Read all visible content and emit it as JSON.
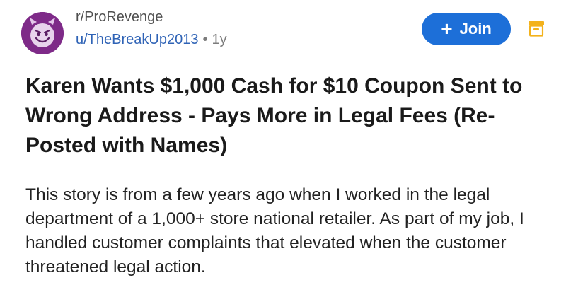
{
  "header": {
    "subreddit": "r/ProRevenge",
    "username": "u/TheBreakUp2013",
    "separator": "•",
    "age": "1y",
    "join_label": "Join",
    "join_plus": "+",
    "avatar_icon": "smiling-devil-icon",
    "archive_icon": "archive-box-icon"
  },
  "post": {
    "title": "Karen Wants $1,000 Cash for $10 Coupon Sent to Wrong Address - Pays More in Legal Fees (Re-Posted with Names)",
    "body": "This story is from a few years ago when I worked in the legal department of a 1,000+ store national retailer. As part of my job, I handled customer complaints that elevated when the customer threatened legal action."
  },
  "colors": {
    "avatar_bg": "#7e2a88",
    "join_bg": "#1d6fd8",
    "username": "#2f63b6",
    "archive_icon": "#f3b21c"
  }
}
